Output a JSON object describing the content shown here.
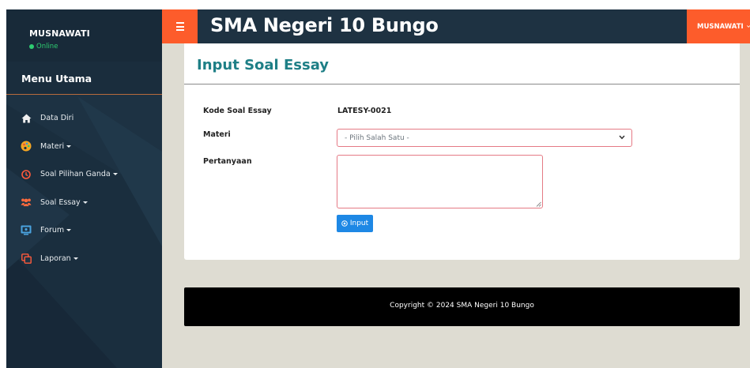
{
  "sidebar": {
    "user_name": "MUSNAWATI",
    "user_status": "Online",
    "menu_header": "Menu Utama",
    "items": [
      {
        "label": "Data Diri",
        "icon": "home-icon",
        "has_caret": false
      },
      {
        "label": "Materi",
        "icon": "palette-icon",
        "has_caret": true
      },
      {
        "label": "Soal Pilihan Ganda",
        "icon": "clock-icon",
        "has_caret": true
      },
      {
        "label": "Soal Essay",
        "icon": "users-icon",
        "has_caret": true
      },
      {
        "label": "Forum",
        "icon": "forum-icon",
        "has_caret": true
      },
      {
        "label": "Laporan",
        "icon": "copy-icon",
        "has_caret": true
      }
    ]
  },
  "topbar": {
    "brand": "SMA Negeri 10 Bungo",
    "user_menu_label": "MUSNAWATI"
  },
  "card": {
    "title": "Input Soal Essay",
    "form": {
      "code_label": "Kode Soal Essay",
      "code_value": "LATESY-0021",
      "materi_label": "Materi",
      "materi_selected": "- Pilih Salah Satu -",
      "pertanyaan_label": "Pertanyaan",
      "pertanyaan_value": "",
      "submit_label": "Input"
    }
  },
  "footer": {
    "copyright": "Copyright © 2024 SMA Negeri 10 Bungo"
  },
  "colors": {
    "sidebar_bg": "#1d3243",
    "accent_orange": "#fd5c2b",
    "title_teal": "#1e7f86",
    "button_blue": "#1e88e5",
    "page_bg": "#dedcd2",
    "online_green": "#2ecc71"
  }
}
